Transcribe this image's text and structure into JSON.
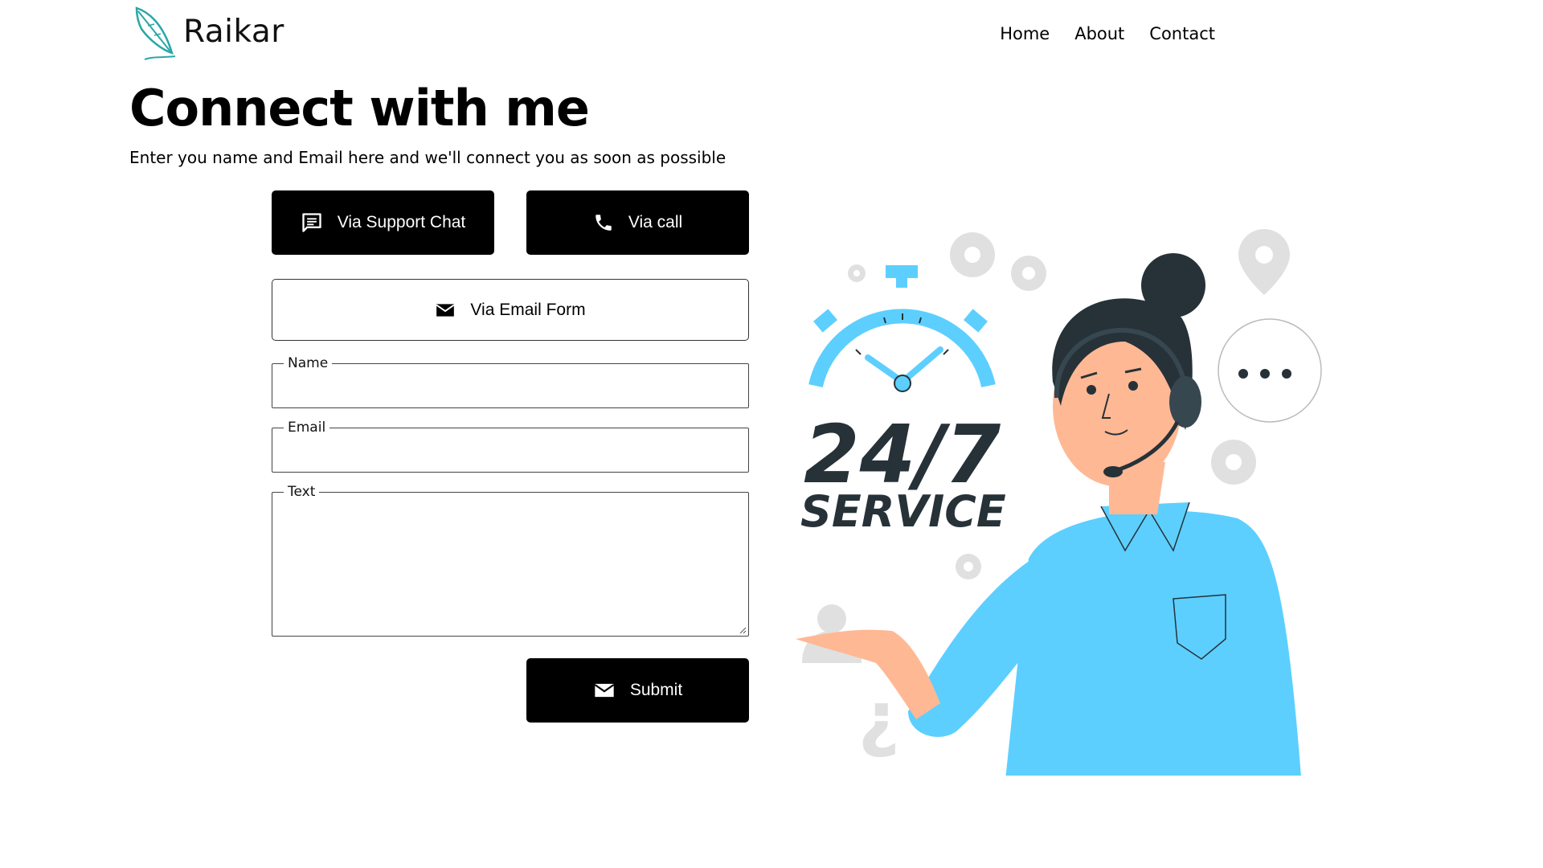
{
  "header": {
    "logo_text": "Raikar",
    "nav": [
      "Home",
      "About",
      "Contact"
    ]
  },
  "main": {
    "title": "Connect with me",
    "subtitle": "Enter you name and Email here and we'll connect you as soon as possible"
  },
  "contact_options": {
    "chat_label": "Via Support Chat",
    "call_label": "Via call",
    "email_label": "Via Email Form"
  },
  "form": {
    "name_label": "Name",
    "name_value": "",
    "email_label": "Email",
    "email_value": "",
    "text_label": "Text",
    "text_value": "",
    "submit_label": "Submit"
  },
  "illustration": {
    "big_text": "24/7",
    "service_text": "SERVICE"
  },
  "colors": {
    "accent": "#5ccfff",
    "logo_teal": "#2aa7a7",
    "button_dark": "#000000",
    "hair": "#263238",
    "skin": "#ffb894",
    "gear_gray": "#e0e0e0"
  },
  "icons": {
    "chat": "chat-icon",
    "call": "phone-icon",
    "email": "envelope-icon",
    "submit": "envelope-icon"
  }
}
